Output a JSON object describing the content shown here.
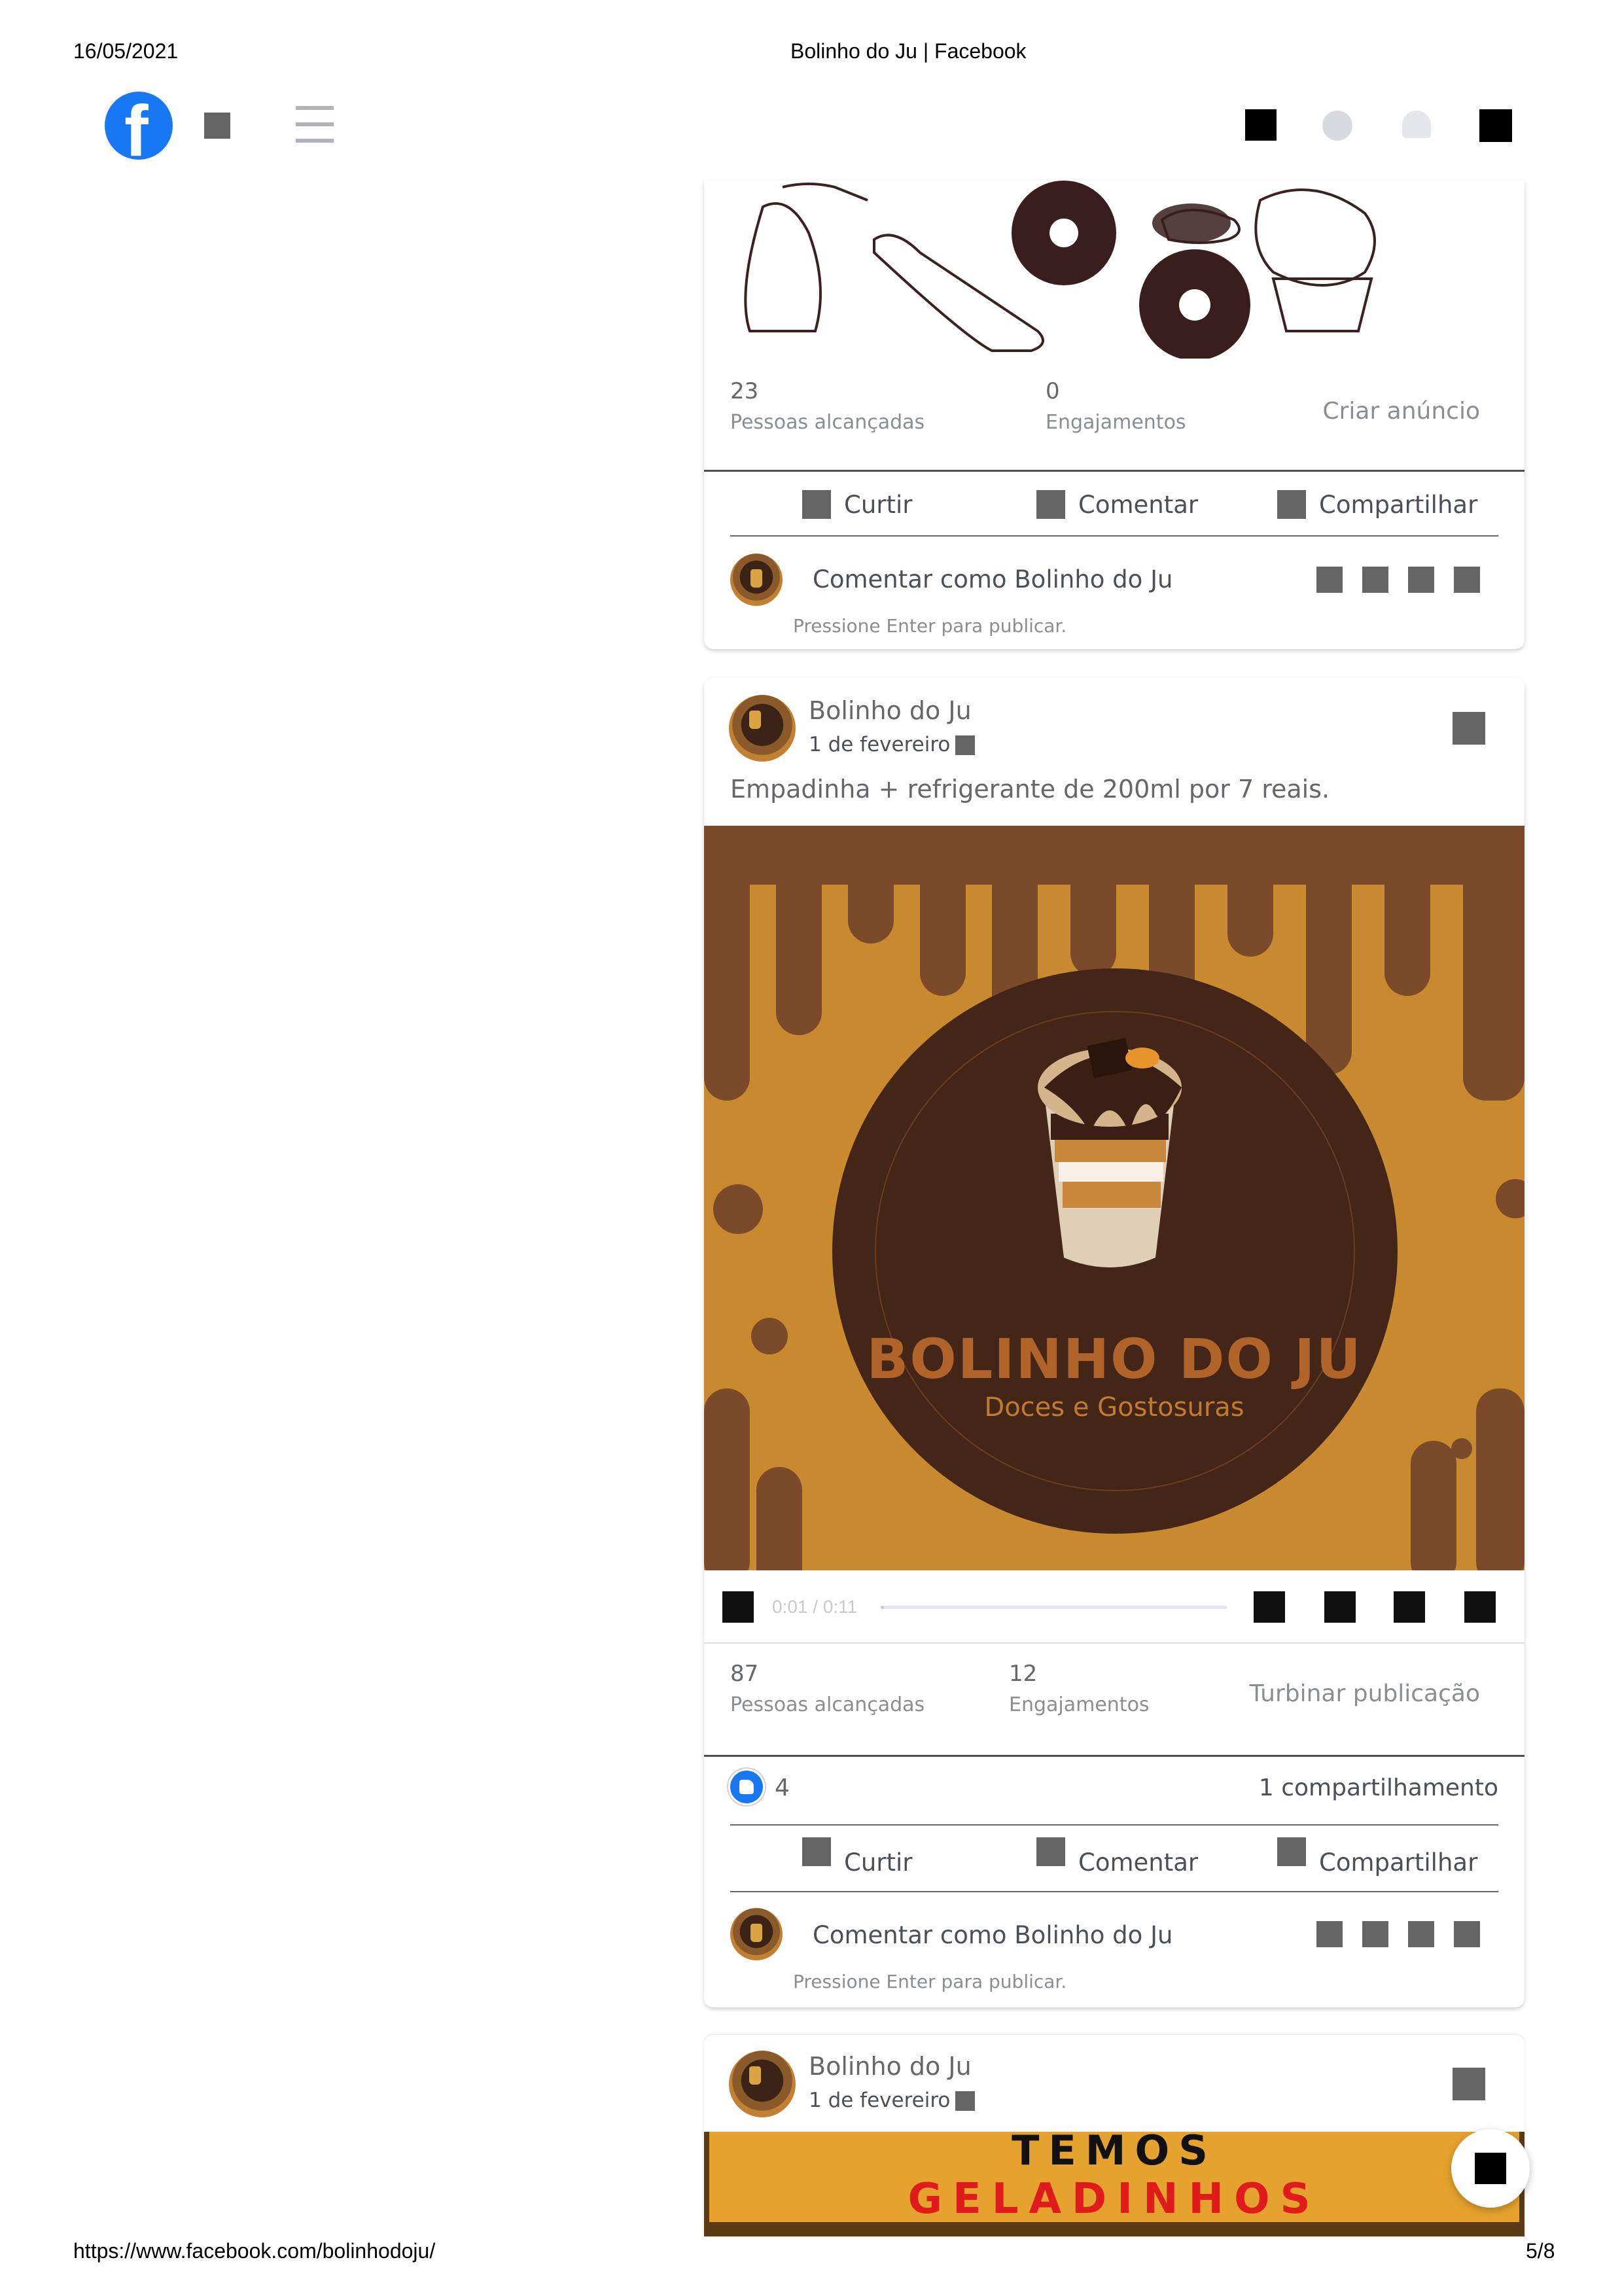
{
  "print_header": {
    "date": "16/05/2021",
    "title": "Bolinho do Ju | Facebook"
  },
  "print_footer": {
    "url": "https://www.facebook.com/bolinhodoju/",
    "page": "5/8"
  },
  "top_nav": {
    "logo_letter": "f",
    "brand_color": "#1877f2",
    "icons": [
      "facebook-logo-icon",
      "square-icon",
      "hamburger-menu-icon",
      "grid-icon",
      "messenger-icon",
      "bell-icon",
      "account-icon"
    ]
  },
  "post1": {
    "stats": {
      "reach_value": "23",
      "reach_label": "Pessoas alcançadas",
      "engagement_value": "0",
      "engagement_label": "Engajamentos",
      "cta": "Criar anúncio"
    },
    "actions": {
      "like": "Curtir",
      "comment": "Comentar",
      "share": "Compartilhar"
    },
    "comment_box": {
      "placeholder": "Comentar como Bolinho do Ju",
      "hint": "Pressione Enter para publicar."
    }
  },
  "post2": {
    "author": "Bolinho do Ju",
    "date": "1 de fevereiro ·",
    "text": "Empadinha + refrigerante de 200ml por 7 reais.",
    "video": {
      "logo_title": "BOLINHO DO JU",
      "logo_subtitle": "Doces e Gostosuras",
      "time": "0:01 / 0:11",
      "progress": 0.01
    },
    "stats": {
      "reach_value": "87",
      "reach_label": "Pessoas alcançadas",
      "engagement_value": "12",
      "engagement_label": "Engajamentos",
      "cta": "Turbinar publicação"
    },
    "reactions": {
      "count": "4",
      "shares": "1 compartilhamento"
    },
    "actions": {
      "like": "Curtir",
      "comment": "Comentar",
      "share": "Compartilhar"
    },
    "comment_box": {
      "placeholder": "Comentar como Bolinho do Ju",
      "hint": "Pressione Enter para publicar."
    }
  },
  "post3": {
    "author": "Bolinho do Ju",
    "date": "1 de fevereiro ·",
    "image_line1": "TEMOS",
    "image_line2": "GELADINHOS"
  }
}
